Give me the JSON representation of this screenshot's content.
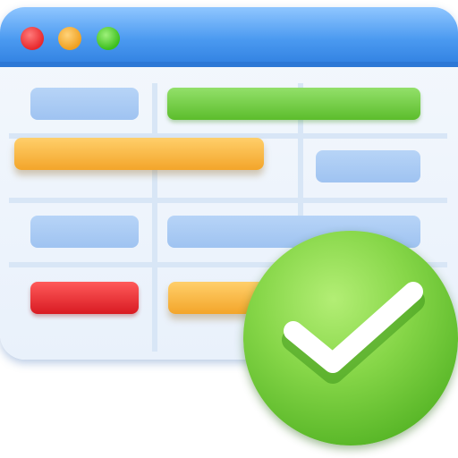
{
  "window": {
    "buttons": [
      {
        "name": "close",
        "color": "#e8282c"
      },
      {
        "name": "minimize",
        "color": "#f0a020"
      },
      {
        "name": "maximize",
        "color": "#3cbf1e"
      }
    ]
  },
  "schedule_bars": [
    {
      "row": 1,
      "color": "blue"
    },
    {
      "row": 1,
      "color": "green"
    },
    {
      "row": 2,
      "color": "orange"
    },
    {
      "row": 2,
      "color": "blue"
    },
    {
      "row": 3,
      "color": "blue"
    },
    {
      "row": 3,
      "color": "blue"
    },
    {
      "row": 4,
      "color": "red"
    },
    {
      "row": 4,
      "color": "orange"
    }
  ],
  "badge": {
    "icon": "checkmark-icon",
    "color": "#5cbd2c"
  }
}
